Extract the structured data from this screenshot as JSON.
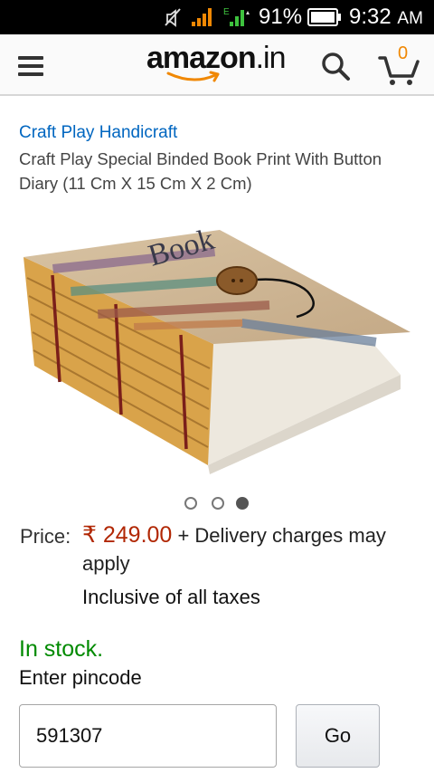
{
  "status_bar": {
    "battery_percent": "91%",
    "time": "9:32",
    "ampm": "AM",
    "icons": [
      "mute-icon",
      "signal-icon",
      "data-signal-icon",
      "battery-icon"
    ]
  },
  "header": {
    "logo_text": "amazon",
    "logo_tld": ".in",
    "cart_count": "0",
    "icons": [
      "menu-icon",
      "search-icon",
      "cart-icon"
    ],
    "colors": {
      "accent": "#f08804",
      "link": "#0066c0",
      "price": "#b12704",
      "stock": "#008a00"
    }
  },
  "product": {
    "brand": "Craft Play Handicraft",
    "title": "Craft Play Special Binded Book Print With Button Diary (11 Cm X 15 Cm X 2 Cm)",
    "image_label": "Book",
    "carousel": {
      "total": 3,
      "active_index": 2
    }
  },
  "pricing": {
    "label": "Price:",
    "value": "₹ 249.00",
    "delivery_note": "+ Delivery charges may apply",
    "tax_note": "Inclusive of all taxes"
  },
  "availability": {
    "stock_text": "In stock.",
    "pincode_label": "Enter pincode",
    "pincode_value": "591307",
    "go_label": "Go"
  }
}
